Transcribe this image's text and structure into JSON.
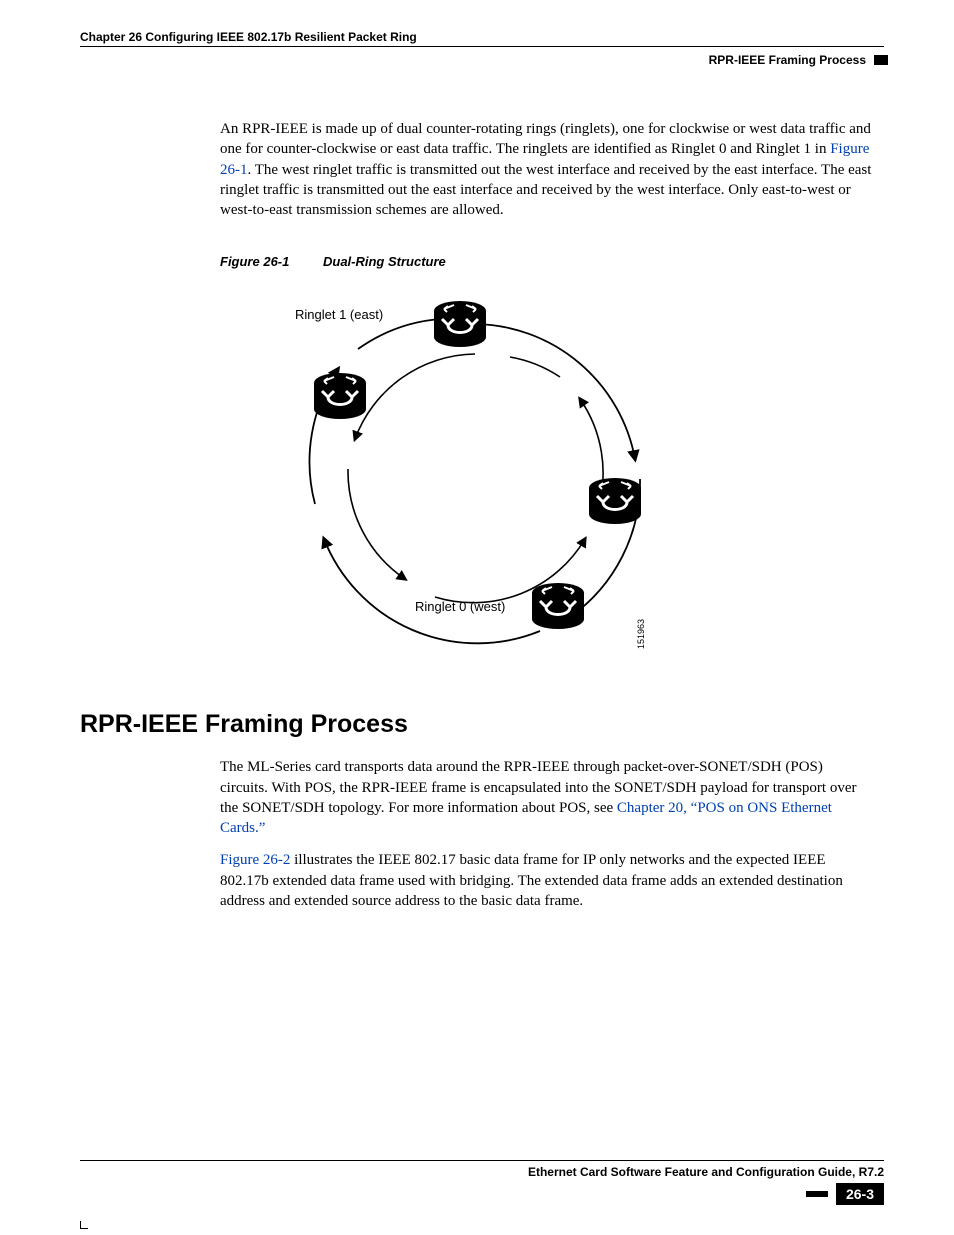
{
  "header": {
    "chapter": "Chapter 26  Configuring IEEE 802.17b Resilient Packet Ring",
    "section": "RPR-IEEE Framing Process"
  },
  "paragraphs": {
    "p1_a": "An RPR-IEEE is made up of dual counter-rotating rings (ringlets), one for clockwise or west data traffic and one for counter-clockwise or east data traffic. The ringlets are identified as Ringlet 0 and Ringlet 1 in ",
    "p1_link": "Figure 26-1",
    "p1_b": ". The west ringlet traffic is transmitted out the west interface and received by the east interface. The east ringlet traffic is transmitted out the east interface and received by the west interface. Only east-to-west or west-to-east transmission schemes are allowed.",
    "p2_a": "The ML-Series card transports data around the RPR-IEEE through packet-over-SONET/SDH (POS) circuits. With POS, the RPR-IEEE frame is encapsulated into the SONET/SDH payload for transport over the SONET/SDH topology. For more information about POS, see ",
    "p2_link": "Chapter 20, “POS on ONS Ethernet Cards.”",
    "p3_link": "Figure 26-2",
    "p3_a": " illustrates the IEEE 802.17 basic data frame for IP only networks and the expected IEEE 802.17b extended data frame used with bridging. The extended data frame adds an extended destination address and extended source address to the basic data frame."
  },
  "figure": {
    "number": "Figure 26-1",
    "title": "Dual-Ring Structure",
    "labels": {
      "ringlet1": "Ringlet 1 (east)",
      "ringlet0": "Ringlet 0 (west)",
      "id": "151963"
    }
  },
  "heading": "RPR-IEEE Framing Process",
  "footer": {
    "guide": "Ethernet Card Software Feature and Configuration Guide, R7.2",
    "page": "26-3"
  },
  "chart_data": {
    "type": "diagram",
    "description": "Dual counter-rotating ring (RPR) structure",
    "nodes": [
      {
        "id": "N1",
        "position": "top"
      },
      {
        "id": "N2",
        "position": "left"
      },
      {
        "id": "N3",
        "position": "right"
      },
      {
        "id": "N4",
        "position": "bottom"
      }
    ],
    "rings": [
      {
        "name": "Ringlet 0 (west)",
        "direction": "clockwise",
        "radius": "outer"
      },
      {
        "name": "Ringlet 1 (east)",
        "direction": "counter-clockwise",
        "radius": "inner"
      }
    ],
    "labels": [
      "Ringlet 1 (east)",
      "Ringlet 0 (west)"
    ],
    "figure_id": "151963"
  }
}
